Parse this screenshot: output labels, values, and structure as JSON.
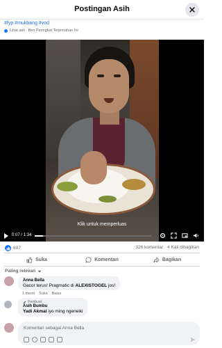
{
  "header": {
    "title": "Postingan Asih"
  },
  "post": {
    "hashtags": "#fyp #mukbang #vod",
    "translate_label": "Lihat asli · Beri Peringkat Terjemahan Ini"
  },
  "video": {
    "overlay_text": "Klik untuk memperluas",
    "time_display": "0:07 / 1:34",
    "progress_fraction": 0.074
  },
  "stats": {
    "reactions": "697",
    "comments": "326 komentar",
    "shares": "4 Kali dibagikan"
  },
  "actions": {
    "like": "Suka",
    "comment": "Komentari",
    "share": "Bagikan"
  },
  "sort_label": "Paling relevan",
  "comments": [
    {
      "author": "Anna Bella",
      "text_before": "Gacor terus! Pragmatic di ",
      "brand": "ALEXISTOGEL",
      "text_after": " jos!",
      "time": "1 menit",
      "like": "Suka",
      "reply": "Balas"
    }
  ],
  "reply": {
    "badge": "Pembuat",
    "author": "Asih Bumbu",
    "mention": "Yadi Akmal",
    "text": " iyo ming ngeneiki"
  },
  "composer": {
    "placeholder": "Komentari sebagai Anna Bella"
  },
  "colors": {
    "accent": "#1877f2",
    "link": "#216fdb",
    "muted": "#65676b",
    "bubble": "#f0f2f5"
  }
}
